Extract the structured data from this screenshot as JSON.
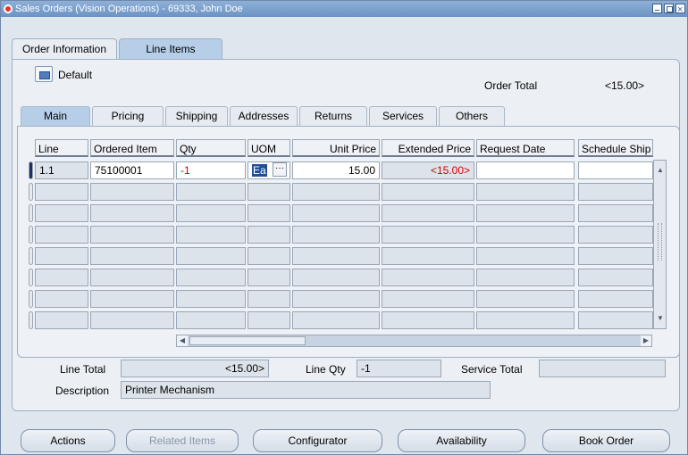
{
  "window": {
    "title": "Sales Orders (Vision Operations) - 69333, John Doe"
  },
  "top_tabs": [
    {
      "label": "Order Information"
    },
    {
      "label": "Line Items"
    }
  ],
  "header": {
    "default_label": "Default",
    "order_total_label": "Order Total",
    "order_total_value": "<15.00>"
  },
  "sub_tabs": [
    {
      "label": "Main"
    },
    {
      "label": "Pricing"
    },
    {
      "label": "Shipping"
    },
    {
      "label": "Addresses"
    },
    {
      "label": "Returns"
    },
    {
      "label": "Services"
    },
    {
      "label": "Others"
    }
  ],
  "table": {
    "columns": [
      "Line",
      "Ordered Item",
      "Qty",
      "UOM",
      "Unit Price",
      "Extended Price",
      "Request Date",
      "Schedule Ship"
    ],
    "rows": [
      {
        "line": "1.1",
        "ordered_item": "75100001",
        "qty": "-1",
        "uom": "Ea",
        "unit_price": "15.00",
        "extended_price": "<15.00>",
        "request_date": "",
        "schedule_ship": ""
      }
    ]
  },
  "footer": {
    "line_total_label": "Line Total",
    "line_total_value": "<15.00>",
    "line_qty_label": "Line Qty",
    "line_qty_value": "-1",
    "service_total_label": "Service Total",
    "service_total_value": "",
    "description_label": "Description",
    "description_value": "Printer Mechanism"
  },
  "buttons": {
    "actions": "Actions",
    "related_items": "Related Items",
    "configurator": "Configurator",
    "availability": "Availability",
    "book_order": "Book Order"
  },
  "colors": {
    "title_bar": "#7fa3cf",
    "active_tab": "#b7cee8",
    "negative_value": "#d40000"
  }
}
